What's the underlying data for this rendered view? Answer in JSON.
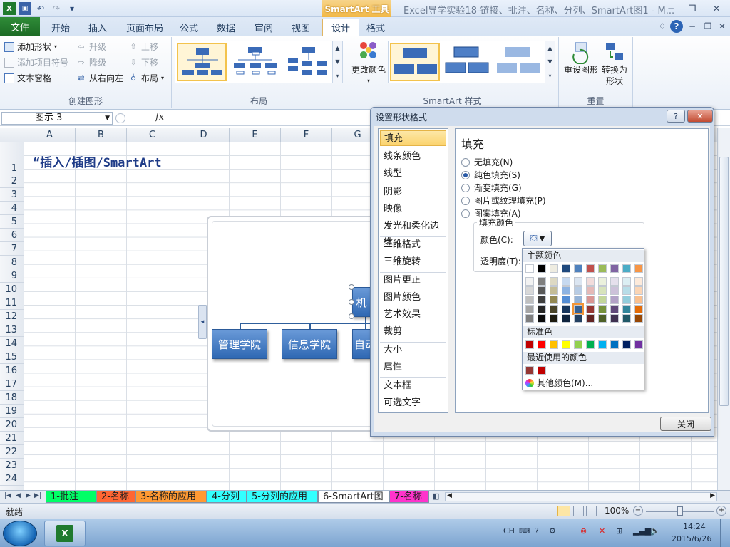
{
  "window": {
    "title": "Excel导学实验18-链接、批注、名称、分列、SmartArt图1 - M...",
    "context_tool": "SmartArt 工具",
    "minimize": "−",
    "restore": "❐",
    "close": "✕",
    "help": "?"
  },
  "qat": {
    "save_icon": "💾",
    "undo_icon": "↶",
    "redo_icon": "↷",
    "customize": "▾"
  },
  "tabs": [
    "文件",
    "开始",
    "插入",
    "页面布局",
    "公式",
    "数据",
    "审阅",
    "视图",
    "设计",
    "格式"
  ],
  "ribbon": {
    "create": {
      "label": "创建图形",
      "add_shape": "添加形状",
      "add_bullet": "添加项目符号",
      "text_pane": "文本窗格",
      "promote": "升级",
      "demote": "降级",
      "rtl": "从右向左",
      "move_up": "上移",
      "move_down": "下移",
      "layout": "布局"
    },
    "layouts": {
      "label": "布局"
    },
    "styles": {
      "label": "SmartArt 样式",
      "change_colors": "更改颜色"
    },
    "reset": {
      "label": "重置",
      "reset_graphic": "重设图形",
      "convert_1": "转换为",
      "convert_2": "形状"
    }
  },
  "formula_bar": {
    "name_box": "图示 3",
    "fx": "fx"
  },
  "columns": [
    "A",
    "B",
    "C",
    "D",
    "E",
    "F",
    "G"
  ],
  "rows": [
    "1",
    "2",
    "3",
    "4",
    "5",
    "6",
    "7",
    "8",
    "9",
    "10",
    "11",
    "12",
    "13",
    "14",
    "15",
    "16",
    "17",
    "18",
    "19",
    "20",
    "21",
    "22",
    "23",
    "24"
  ],
  "cell_a1": "“插入/插图/SmartArt",
  "smartart": {
    "top_box": "机",
    "boxes": [
      "管理学院",
      "信息学院",
      "自动"
    ]
  },
  "dialog": {
    "title": "设置形状格式",
    "help": "?",
    "nav": [
      "填充",
      "线条颜色",
      "线型",
      "阴影",
      "映像",
      "发光和柔化边缘",
      "三维格式",
      "三维旋转",
      "图片更正",
      "图片颜色",
      "艺术效果",
      "裁剪",
      "大小",
      "属性",
      "文本框",
      "可选文字"
    ],
    "panel_title": "填充",
    "options": [
      "无填充(N)",
      "纯色填充(S)",
      "渐变填充(G)",
      "图片或纹理填充(P)",
      "图案填充(A)"
    ],
    "selected_option": 1,
    "fill_color_group": "填充颜色",
    "color_label": "颜色(C):",
    "transparency_label": "透明度(T):",
    "close_button": "关闭"
  },
  "palette": {
    "theme_header": "主题颜色",
    "standard_header": "标准色",
    "recent_header": "最近使用的颜色",
    "more_colors": "其他颜色(M)...",
    "theme_top": [
      "#FFFFFF",
      "#000000",
      "#EEECE1",
      "#1F497D",
      "#4F81BD",
      "#C0504D",
      "#9BBB59",
      "#8064A2",
      "#4BACC6",
      "#F79646"
    ],
    "theme_shades": [
      [
        "#F2F2F2",
        "#7F7F7F",
        "#DDD9C3",
        "#C6D9F0",
        "#DBE5F1",
        "#F2DCDB",
        "#EBF1DD",
        "#E5E0EC",
        "#DBEEF3",
        "#FDEADA"
      ],
      [
        "#D8D8D8",
        "#595959",
        "#C4BD97",
        "#8DB3E2",
        "#B8CCE4",
        "#E5B9B7",
        "#D7E3BC",
        "#CCC1D9",
        "#B7DDE8",
        "#FBD5B5"
      ],
      [
        "#BFBFBF",
        "#3F3F3F",
        "#938953",
        "#548DD4",
        "#95B3D7",
        "#D99694",
        "#C3D69B",
        "#B2A2C7",
        "#92CDDC",
        "#FAC08F"
      ],
      [
        "#A5A5A5",
        "#262626",
        "#494429",
        "#17365D",
        "#366092",
        "#953734",
        "#76923C",
        "#5F497A",
        "#31859B",
        "#E36C09"
      ],
      [
        "#7F7F7F",
        "#0C0C0C",
        "#1D1B10",
        "#0F243E",
        "#244061",
        "#632423",
        "#4F6128",
        "#3F3151",
        "#205867",
        "#974806"
      ]
    ],
    "selected_swatch": "#366092",
    "standard": [
      "#C00000",
      "#FF0000",
      "#FFC000",
      "#FFFF00",
      "#92D050",
      "#00B050",
      "#00B0F0",
      "#0070C0",
      "#002060",
      "#7030A0"
    ],
    "recent": [
      "#953734",
      "#C00000"
    ]
  },
  "sheet_tabs": [
    {
      "label": "1-批注",
      "color": "#00FF66"
    },
    {
      "label": "2-名称",
      "color": "#FF6633"
    },
    {
      "label": "3-名称的应用",
      "color": "#FF9933"
    },
    {
      "label": "4-分列",
      "color": "#33FFFF"
    },
    {
      "label": "5-分列的应用",
      "color": "#33FFFF"
    },
    {
      "label": "6-SmartArt图",
      "color": "#FFFFFF"
    },
    {
      "label": "7-名称",
      "color": "#FF33CC"
    }
  ],
  "status": {
    "ready": "就绪",
    "zoom": "100%"
  },
  "taskbar": {
    "ime": "CH",
    "time": "14:24",
    "date": "2015/6/26"
  }
}
